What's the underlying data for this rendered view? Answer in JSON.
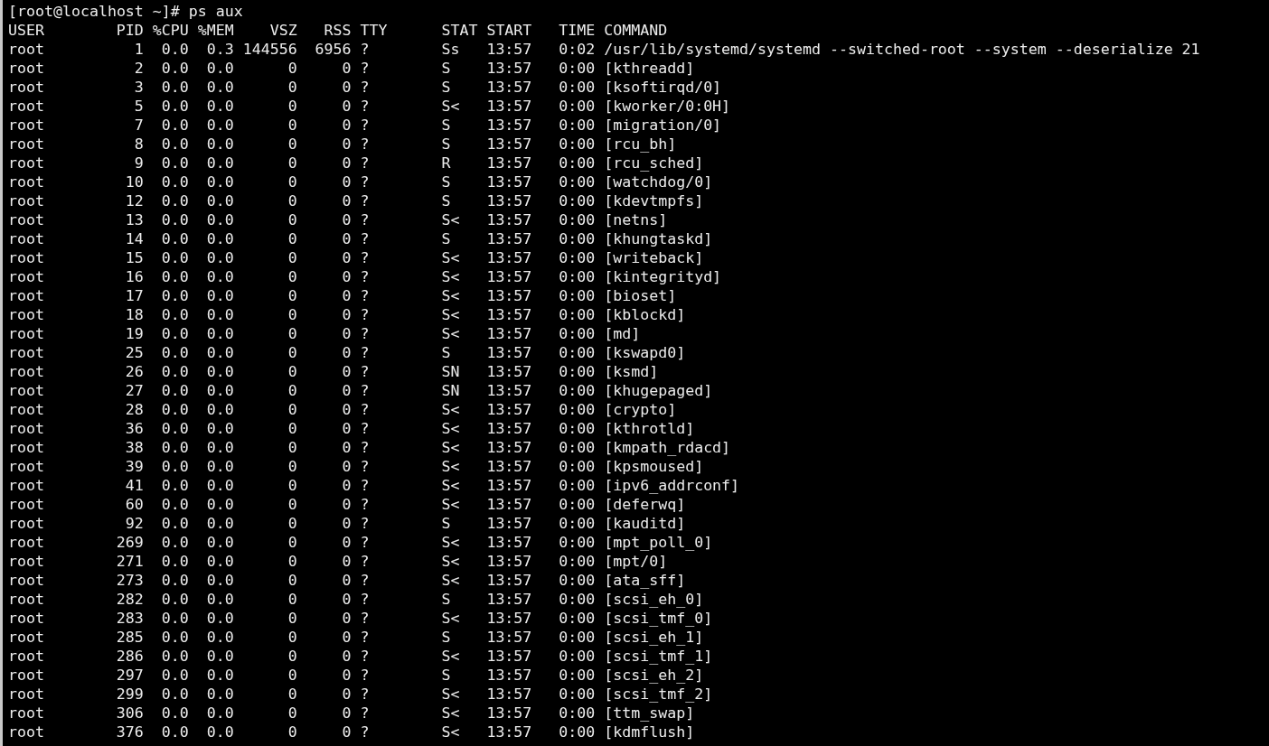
{
  "terminal": {
    "prompt": "[root@localhost ~]# ps aux",
    "columns": [
      "USER",
      "PID",
      "%CPU",
      "%MEM",
      "VSZ",
      "RSS",
      "TTY",
      "STAT",
      "START",
      "TIME",
      "COMMAND"
    ],
    "rows": [
      [
        "root",
        "1",
        "0.0",
        "0.3",
        "144556",
        "6956",
        "?",
        "Ss",
        "13:57",
        "0:02",
        "/usr/lib/systemd/systemd --switched-root --system --deserialize 21"
      ],
      [
        "root",
        "2",
        "0.0",
        "0.0",
        "0",
        "0",
        "?",
        "S",
        "13:57",
        "0:00",
        "[kthreadd]"
      ],
      [
        "root",
        "3",
        "0.0",
        "0.0",
        "0",
        "0",
        "?",
        "S",
        "13:57",
        "0:00",
        "[ksoftirqd/0]"
      ],
      [
        "root",
        "5",
        "0.0",
        "0.0",
        "0",
        "0",
        "?",
        "S<",
        "13:57",
        "0:00",
        "[kworker/0:0H]"
      ],
      [
        "root",
        "7",
        "0.0",
        "0.0",
        "0",
        "0",
        "?",
        "S",
        "13:57",
        "0:00",
        "[migration/0]"
      ],
      [
        "root",
        "8",
        "0.0",
        "0.0",
        "0",
        "0",
        "?",
        "S",
        "13:57",
        "0:00",
        "[rcu_bh]"
      ],
      [
        "root",
        "9",
        "0.0",
        "0.0",
        "0",
        "0",
        "?",
        "R",
        "13:57",
        "0:00",
        "[rcu_sched]"
      ],
      [
        "root",
        "10",
        "0.0",
        "0.0",
        "0",
        "0",
        "?",
        "S",
        "13:57",
        "0:00",
        "[watchdog/0]"
      ],
      [
        "root",
        "12",
        "0.0",
        "0.0",
        "0",
        "0",
        "?",
        "S",
        "13:57",
        "0:00",
        "[kdevtmpfs]"
      ],
      [
        "root",
        "13",
        "0.0",
        "0.0",
        "0",
        "0",
        "?",
        "S<",
        "13:57",
        "0:00",
        "[netns]"
      ],
      [
        "root",
        "14",
        "0.0",
        "0.0",
        "0",
        "0",
        "?",
        "S",
        "13:57",
        "0:00",
        "[khungtaskd]"
      ],
      [
        "root",
        "15",
        "0.0",
        "0.0",
        "0",
        "0",
        "?",
        "S<",
        "13:57",
        "0:00",
        "[writeback]"
      ],
      [
        "root",
        "16",
        "0.0",
        "0.0",
        "0",
        "0",
        "?",
        "S<",
        "13:57",
        "0:00",
        "[kintegrityd]"
      ],
      [
        "root",
        "17",
        "0.0",
        "0.0",
        "0",
        "0",
        "?",
        "S<",
        "13:57",
        "0:00",
        "[bioset]"
      ],
      [
        "root",
        "18",
        "0.0",
        "0.0",
        "0",
        "0",
        "?",
        "S<",
        "13:57",
        "0:00",
        "[kblockd]"
      ],
      [
        "root",
        "19",
        "0.0",
        "0.0",
        "0",
        "0",
        "?",
        "S<",
        "13:57",
        "0:00",
        "[md]"
      ],
      [
        "root",
        "25",
        "0.0",
        "0.0",
        "0",
        "0",
        "?",
        "S",
        "13:57",
        "0:00",
        "[kswapd0]"
      ],
      [
        "root",
        "26",
        "0.0",
        "0.0",
        "0",
        "0",
        "?",
        "SN",
        "13:57",
        "0:00",
        "[ksmd]"
      ],
      [
        "root",
        "27",
        "0.0",
        "0.0",
        "0",
        "0",
        "?",
        "SN",
        "13:57",
        "0:00",
        "[khugepaged]"
      ],
      [
        "root",
        "28",
        "0.0",
        "0.0",
        "0",
        "0",
        "?",
        "S<",
        "13:57",
        "0:00",
        "[crypto]"
      ],
      [
        "root",
        "36",
        "0.0",
        "0.0",
        "0",
        "0",
        "?",
        "S<",
        "13:57",
        "0:00",
        "[kthrotld]"
      ],
      [
        "root",
        "38",
        "0.0",
        "0.0",
        "0",
        "0",
        "?",
        "S<",
        "13:57",
        "0:00",
        "[kmpath_rdacd]"
      ],
      [
        "root",
        "39",
        "0.0",
        "0.0",
        "0",
        "0",
        "?",
        "S<",
        "13:57",
        "0:00",
        "[kpsmoused]"
      ],
      [
        "root",
        "41",
        "0.0",
        "0.0",
        "0",
        "0",
        "?",
        "S<",
        "13:57",
        "0:00",
        "[ipv6_addrconf]"
      ],
      [
        "root",
        "60",
        "0.0",
        "0.0",
        "0",
        "0",
        "?",
        "S<",
        "13:57",
        "0:00",
        "[deferwq]"
      ],
      [
        "root",
        "92",
        "0.0",
        "0.0",
        "0",
        "0",
        "?",
        "S",
        "13:57",
        "0:00",
        "[kauditd]"
      ],
      [
        "root",
        "269",
        "0.0",
        "0.0",
        "0",
        "0",
        "?",
        "S<",
        "13:57",
        "0:00",
        "[mpt_poll_0]"
      ],
      [
        "root",
        "271",
        "0.0",
        "0.0",
        "0",
        "0",
        "?",
        "S<",
        "13:57",
        "0:00",
        "[mpt/0]"
      ],
      [
        "root",
        "273",
        "0.0",
        "0.0",
        "0",
        "0",
        "?",
        "S<",
        "13:57",
        "0:00",
        "[ata_sff]"
      ],
      [
        "root",
        "282",
        "0.0",
        "0.0",
        "0",
        "0",
        "?",
        "S",
        "13:57",
        "0:00",
        "[scsi_eh_0]"
      ],
      [
        "root",
        "283",
        "0.0",
        "0.0",
        "0",
        "0",
        "?",
        "S<",
        "13:57",
        "0:00",
        "[scsi_tmf_0]"
      ],
      [
        "root",
        "285",
        "0.0",
        "0.0",
        "0",
        "0",
        "?",
        "S",
        "13:57",
        "0:00",
        "[scsi_eh_1]"
      ],
      [
        "root",
        "286",
        "0.0",
        "0.0",
        "0",
        "0",
        "?",
        "S<",
        "13:57",
        "0:00",
        "[scsi_tmf_1]"
      ],
      [
        "root",
        "297",
        "0.0",
        "0.0",
        "0",
        "0",
        "?",
        "S",
        "13:57",
        "0:00",
        "[scsi_eh_2]"
      ],
      [
        "root",
        "299",
        "0.0",
        "0.0",
        "0",
        "0",
        "?",
        "S<",
        "13:57",
        "0:00",
        "[scsi_tmf_2]"
      ],
      [
        "root",
        "306",
        "0.0",
        "0.0",
        "0",
        "0",
        "?",
        "S<",
        "13:57",
        "0:00",
        "[ttm_swap]"
      ],
      [
        "root",
        "376",
        "0.0",
        "0.0",
        "0",
        "0",
        "?",
        "S<",
        "13:57",
        "0:00",
        "[kdmflush]"
      ]
    ]
  }
}
